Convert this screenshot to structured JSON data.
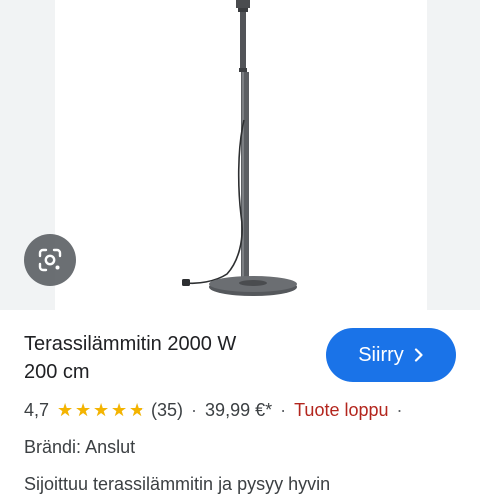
{
  "product": {
    "title_line1": "Terassilämmitin 2000 W",
    "title_line2": "200 cm",
    "rating": "4,7",
    "rating_value": 4.7,
    "reviews": "(35)",
    "price": "39,99 €*",
    "availability": "Tuote loppu",
    "trailing_separator": "·",
    "brand_label": "Brändi:",
    "brand_value": "Anslut",
    "description_partial": "Sijoittuu terassilämmitin ja pysyy hyvin"
  },
  "actions": {
    "go_label": "Siirry"
  },
  "icons": {
    "lens": "google-lens-icon",
    "chevron": "chevron-right-icon",
    "star": "star-icon"
  },
  "colors": {
    "accent": "#1a73e8",
    "star": "#f4b400",
    "out_of_stock": "#b3261e"
  }
}
